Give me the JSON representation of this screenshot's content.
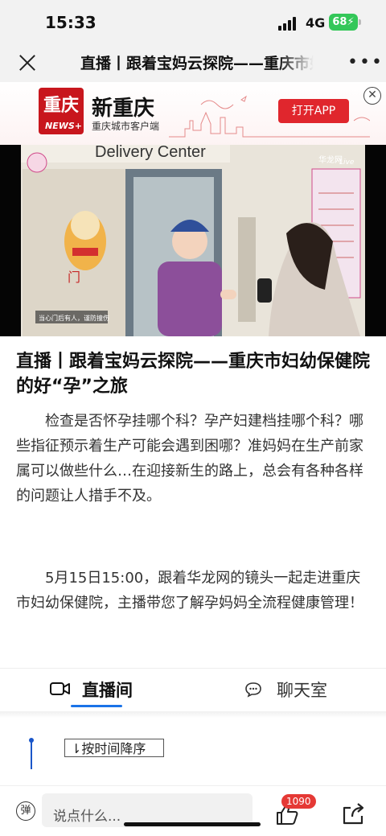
{
  "status_bar": {
    "time": "15:33",
    "network": "4G",
    "battery": "68"
  },
  "nav": {
    "title": "直播丨跟着宝妈云探院——重庆市妇幼保健院的好“孕”之旅",
    "more_icon": "more-icon"
  },
  "banner": {
    "logo_cn": "重庆",
    "logo_en": "NEWS+",
    "brand": "新重庆",
    "subtitle": "重庆城市客户端",
    "open_app": "打开APP"
  },
  "video": {
    "sign_text": "Delivery Center",
    "door_label": "门",
    "notice": "当心门后有人，谨防撞伤",
    "watermark": "华龙网",
    "watermark_live": "Live"
  },
  "article": {
    "title": "直播丨跟着宝妈云探院——重庆市妇幼保健院的好“孕”之旅",
    "paragraphs": [
      "检查是否怀孕挂哪个科？孕产妇建档挂哪个科？哪些指征预示着生产可能会遇到困哪？准妈妈在生产前家属可以做些什么…在迎接新生的路上，总会有各种各样的问题让人措手不及。",
      "5月15日15:00，跟着华龙网的镜头一起走进重庆市妇幼保健院，主播带您了解孕妈妈全流程健康管理！"
    ]
  },
  "tabs": [
    {
      "label": "直播间",
      "icon": "video-camera-icon",
      "active": true
    },
    {
      "label": "聊天室",
      "icon": "chat-bubble-icon",
      "active": false
    }
  ],
  "sort": {
    "label": "按时间降序"
  },
  "bottom": {
    "danmu": "弹",
    "comment_placeholder": "说点什么...",
    "likes": "1090"
  },
  "colors": {
    "accent": "#1a73e8",
    "brand_red": "#c8161d",
    "battery_green": "#34c759"
  }
}
